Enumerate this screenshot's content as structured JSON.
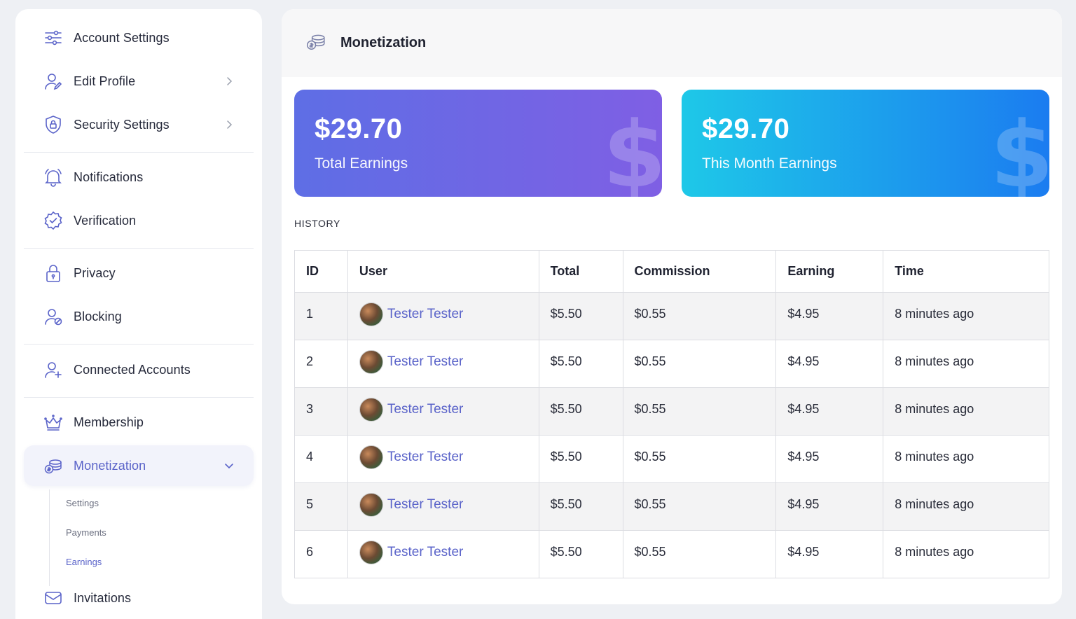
{
  "sidebar": {
    "items": [
      {
        "label": "Account Settings",
        "icon": "sliders-icon"
      },
      {
        "label": "Edit Profile",
        "icon": "user-edit-icon"
      },
      {
        "label": "Security Settings",
        "icon": "shield-lock-icon"
      },
      {
        "label": "Notifications",
        "icon": "bell-icon"
      },
      {
        "label": "Verification",
        "icon": "badge-check-icon"
      },
      {
        "label": "Privacy",
        "icon": "lock-icon"
      },
      {
        "label": "Blocking",
        "icon": "user-block-icon"
      },
      {
        "label": "Connected Accounts",
        "icon": "user-plus-icon"
      },
      {
        "label": "Membership",
        "icon": "crown-icon"
      },
      {
        "label": "Monetization",
        "icon": "coins-icon"
      },
      {
        "label": "Invitations",
        "icon": "mail-icon"
      }
    ],
    "subitems": [
      "Settings",
      "Payments",
      "Earnings"
    ]
  },
  "main": {
    "title": "Monetization",
    "cards": {
      "total": {
        "amount": "$29.70",
        "caption": "Total Earnings",
        "symbol": "$"
      },
      "month": {
        "amount": "$29.70",
        "caption": "This Month Earnings",
        "symbol": "$"
      }
    },
    "history_label": "HISTORY",
    "table": {
      "headers": [
        "ID",
        "User",
        "Total",
        "Commission",
        "Earning",
        "Time"
      ],
      "rows": [
        {
          "id": "1",
          "user": "Tester Tester",
          "total": "$5.50",
          "commission": "$0.55",
          "earning": "$4.95",
          "time": "8 minutes ago"
        },
        {
          "id": "2",
          "user": "Tester Tester",
          "total": "$5.50",
          "commission": "$0.55",
          "earning": "$4.95",
          "time": "8 minutes ago"
        },
        {
          "id": "3",
          "user": "Tester Tester",
          "total": "$5.50",
          "commission": "$0.55",
          "earning": "$4.95",
          "time": "8 minutes ago"
        },
        {
          "id": "4",
          "user": "Tester Tester",
          "total": "$5.50",
          "commission": "$0.55",
          "earning": "$4.95",
          "time": "8 minutes ago"
        },
        {
          "id": "5",
          "user": "Tester Tester",
          "total": "$5.50",
          "commission": "$0.55",
          "earning": "$4.95",
          "time": "8 minutes ago"
        },
        {
          "id": "6",
          "user": "Tester Tester",
          "total": "$5.50",
          "commission": "$0.55",
          "earning": "$4.95",
          "time": "8 minutes ago"
        }
      ]
    }
  },
  "colors": {
    "accent": "#5a63c9",
    "card_total_start": "#5e6ee5",
    "card_total_end": "#7f5fe4",
    "card_month_start": "#1ec8e8",
    "card_month_end": "#1b7cf0"
  }
}
